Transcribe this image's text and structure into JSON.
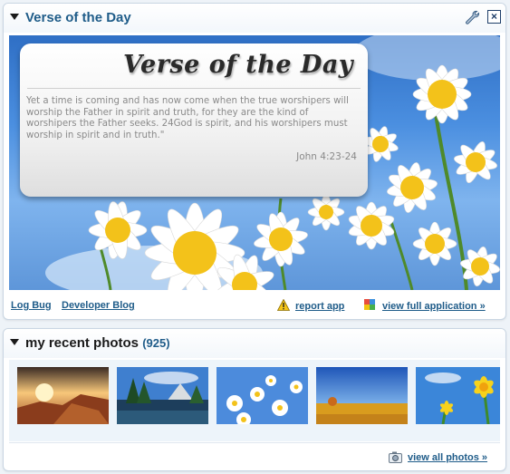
{
  "verse_widget": {
    "title": "Verse of the Day",
    "card_heading": "Verse of the Day",
    "verse_text": "Yet a time is coming and has now come when the true worshipers will worship the Father in spirit and truth, for they are the kind of worshipers the Father seeks. 24God is spirit, and his worshipers must worship in spirit and in truth.\"",
    "reference": "John 4:23-24",
    "footer": {
      "log_bug": "Log Bug",
      "developer_blog": "Developer Blog",
      "report_app": "report app",
      "view_full_application": "view full application »"
    }
  },
  "photos_widget": {
    "title": "my recent photos",
    "count": "(925)",
    "view_all": "view all photos »"
  },
  "colors": {
    "title_blue": "#1f5c89",
    "page_background": "#eef3f8"
  },
  "icons": [
    "caret-down-icon",
    "wrench-icon",
    "close-icon",
    "warning-icon",
    "application-icon",
    "camera-icon"
  ]
}
